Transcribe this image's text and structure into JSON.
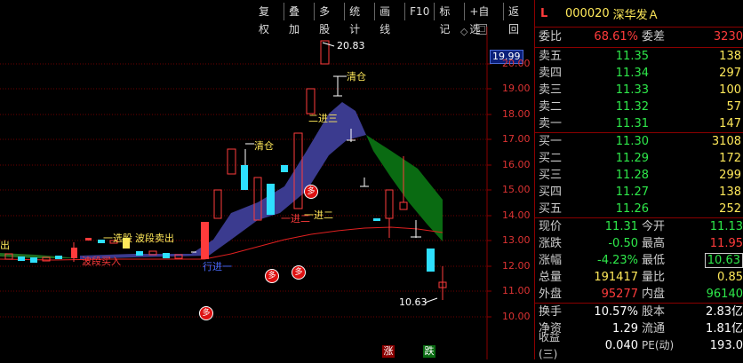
{
  "toolbar": [
    "复权",
    "叠加",
    "多股",
    "统计",
    "画线",
    "F10",
    "标记",
    "+自选",
    "返回"
  ],
  "chart": {
    "price_tag": "19.99",
    "y_ticks": [
      "20.00",
      "19.00",
      "18.00",
      "17.00",
      "16.00",
      "15.00",
      "14.00",
      "13.00",
      "12.00",
      "11.00",
      "10.00"
    ],
    "max_label": "20.83",
    "min_label": "10.63",
    "annotations": {
      "chu": "出",
      "xuangu": "一选股",
      "boduan_sell": "波段卖出",
      "boduan_buy": "波段买入",
      "qingcang1": "清仓",
      "qingcang2": "清仓",
      "erjinsan": "二进三",
      "yijiner": "一进二",
      "jinyer": "一进二",
      "xingjinyi": "行进一"
    },
    "badge_text": "多",
    "bottom_up": "涨",
    "bottom_down": "跌"
  },
  "panel": {
    "marker": "L",
    "code": "000020",
    "name": "深华发Ａ",
    "weibi_label": "委比",
    "weibi_value": "68.61%",
    "weicha_label": "委差",
    "weicha_value": "3230",
    "sells": [
      {
        "label": "卖五",
        "price": "11.35",
        "vol": "138"
      },
      {
        "label": "卖四",
        "price": "11.34",
        "vol": "297"
      },
      {
        "label": "卖三",
        "price": "11.33",
        "vol": "100"
      },
      {
        "label": "卖二",
        "price": "11.32",
        "vol": "57"
      },
      {
        "label": "卖一",
        "price": "11.31",
        "vol": "147"
      }
    ],
    "buys": [
      {
        "label": "买一",
        "price": "11.30",
        "vol": "3108"
      },
      {
        "label": "买二",
        "price": "11.29",
        "vol": "172"
      },
      {
        "label": "买三",
        "price": "11.28",
        "vol": "299"
      },
      {
        "label": "买四",
        "price": "11.27",
        "vol": "138"
      },
      {
        "label": "买五",
        "price": "11.26",
        "vol": "252"
      }
    ],
    "stats": [
      {
        "l1": "现价",
        "v1": "11.31",
        "l2": "今开",
        "v2": "11.13"
      },
      {
        "l1": "涨跌",
        "v1": "-0.50",
        "l2": "最高",
        "v2": "11.95"
      },
      {
        "l1": "涨幅",
        "v1": "-4.23%",
        "l2": "最低",
        "v2": "10.63"
      },
      {
        "l1": "总量",
        "v1": "191417",
        "l2": "量比",
        "v2": "0.85"
      },
      {
        "l1": "外盘",
        "v1": "95277",
        "l2": "内盘",
        "v2": "96140"
      }
    ],
    "stats2": [
      {
        "l1": "换手",
        "v1": "10.57%",
        "l2": "股本",
        "v2": "2.83亿"
      },
      {
        "l1": "净资",
        "v1": "1.29",
        "l2": "流通",
        "v2": "1.81亿"
      },
      {
        "l1": "收益(三)",
        "v1": "0.040",
        "l2": "PE(动)",
        "v2": "193.0"
      }
    ]
  }
}
